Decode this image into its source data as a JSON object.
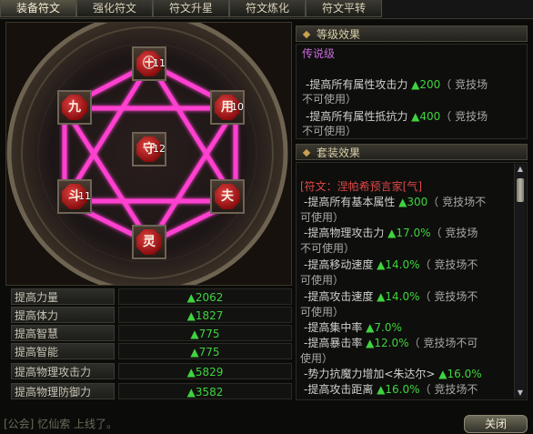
{
  "tabs": [
    {
      "label": "装备符文"
    },
    {
      "label": "强化符文"
    },
    {
      "label": "符文升星"
    },
    {
      "label": "符文炼化"
    },
    {
      "label": "符文平转"
    }
  ],
  "rune_slots": [
    {
      "glyph": "㊉",
      "level": "11"
    },
    {
      "glyph": "九",
      "level": ""
    },
    {
      "glyph": "用",
      "level": "10"
    },
    {
      "glyph": "守",
      "level": "12"
    },
    {
      "glyph": "斗",
      "level": "11"
    },
    {
      "glyph": "夫",
      "level": ""
    },
    {
      "glyph": "灵",
      "level": ""
    }
  ],
  "stats": [
    {
      "label": "提高力量",
      "value": "▲2062"
    },
    {
      "label": "提高体力",
      "value": "▲1827"
    },
    {
      "label": "提高智慧",
      "value": "▲775"
    },
    {
      "label": "提高智能",
      "value": "▲775"
    },
    {
      "label": "提高物理攻击力",
      "value": "▲5829"
    },
    {
      "label": "提高物理防御力",
      "value": "▲3582"
    }
  ],
  "level_effect": {
    "header": "等级效果",
    "tier": "传说级",
    "lines": [
      {
        "text": "-提高所有属性攻击力 ",
        "value": "▲200",
        "note": "（ 竞技场"
      },
      {
        "text": "不可使用）",
        "value": "",
        "note": ""
      },
      {
        "text": "-提高所有属性抵抗力 ",
        "value": "▲400",
        "note": "（ 竞技场"
      },
      {
        "text": "不可使用）",
        "value": "",
        "note": ""
      }
    ]
  },
  "set_effect": {
    "header": "套装效果",
    "set_name": "[符文：涅帕希预言家[气]",
    "lines": [
      {
        "text": "-提高所有基本属性 ",
        "value": "▲300",
        "note": "（ 竞技场不"
      },
      {
        "text": "可使用）",
        "value": "",
        "note": ""
      },
      {
        "text": "-提高物理攻击力 ",
        "value": "▲17.0%",
        "note": "（ 竞技场"
      },
      {
        "text": "不可使用）",
        "value": "",
        "note": ""
      },
      {
        "text": "-提高移动速度 ",
        "value": "▲14.0%",
        "note": "（ 竞技场不"
      },
      {
        "text": "可使用）",
        "value": "",
        "note": ""
      },
      {
        "text": "-提高攻击速度 ",
        "value": "▲14.0%",
        "note": "（ 竞技场不"
      },
      {
        "text": "可使用）",
        "value": "",
        "note": ""
      },
      {
        "text": "-提高集中率 ",
        "value": "▲7.0%",
        "note": ""
      },
      {
        "text": "-提高暴击率 ",
        "value": "▲12.0%",
        "note": "（ 竞技场不可"
      },
      {
        "text": "使用）",
        "value": "",
        "note": ""
      },
      {
        "text": "-势力抗魔力增加<朱达尔> ",
        "value": "▲16.0%",
        "note": ""
      },
      {
        "text": "-提高攻击距离 ",
        "value": "▲16.0%",
        "note": "（ 竞技场不"
      }
    ]
  },
  "chat": {
    "channel": "[公会]",
    "message": "忆仙索 上线了。"
  },
  "close_button": "关闭",
  "colors": {
    "accent_green": "#3fd33f",
    "tier_purple": "#c66bd8",
    "set_red": "#e04848",
    "hexagram_pink": "#ff3fd0"
  }
}
